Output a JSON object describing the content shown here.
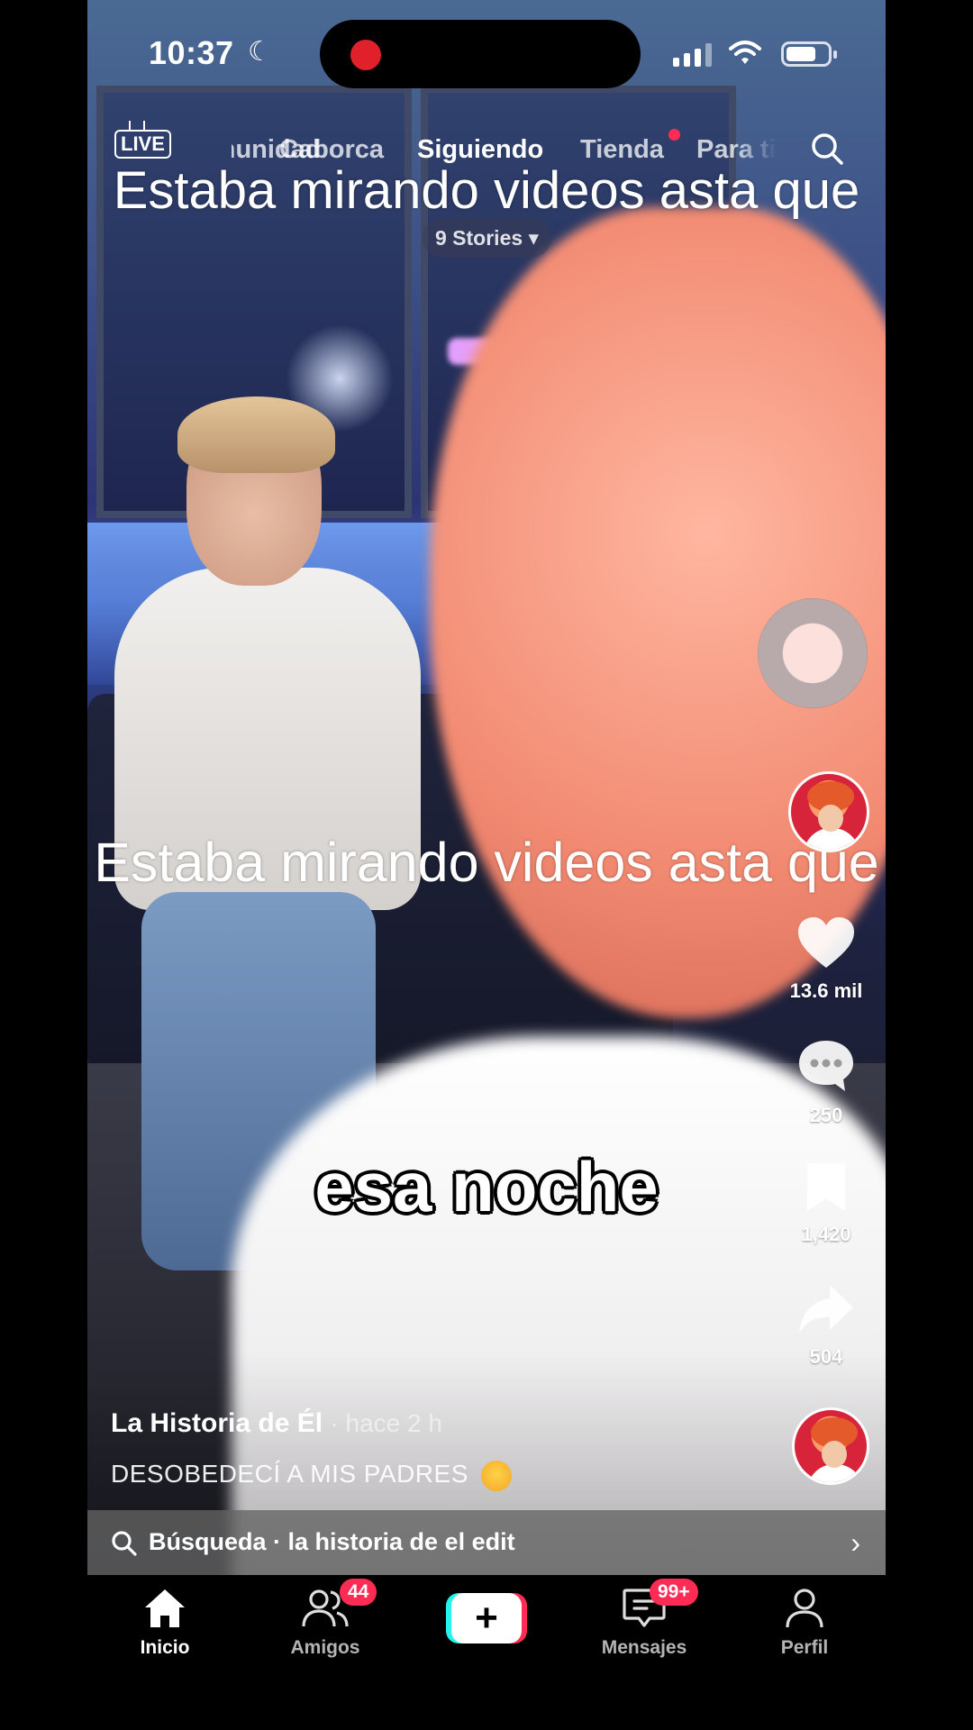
{
  "status_bar": {
    "time": "10:37"
  },
  "top_nav": {
    "live_label": "LIVE",
    "tabs": [
      "Comunidad",
      "Caborca",
      "Siguiendo",
      "Tienda",
      "Para ti"
    ],
    "active_tab": "Siguiendo"
  },
  "stories_label": "9 Stories",
  "captions": {
    "overlay_top": "Estaba mirando videos asta que",
    "overlay_middle": "Estaba mirando videos asta que",
    "video_subtitle": "esa noche"
  },
  "side_rail": {
    "likes": "13.6 mil",
    "comments": "250",
    "saves": "1,420",
    "shares": "504"
  },
  "post": {
    "author": "La Historia de Él",
    "time_ago": "· hace 2 h",
    "description": "DESOBEDECÍ A MIS PADRES"
  },
  "search_bar": {
    "text": "Búsqueda · la historia de el edit"
  },
  "tab_bar": {
    "home": "Inicio",
    "friends": "Amigos",
    "friends_badge": "44",
    "messages": "Mensajes",
    "messages_badge": "99+",
    "profile": "Perfil"
  },
  "colors": {
    "accent": "#fe2c55",
    "cyan": "#25f4ee"
  }
}
